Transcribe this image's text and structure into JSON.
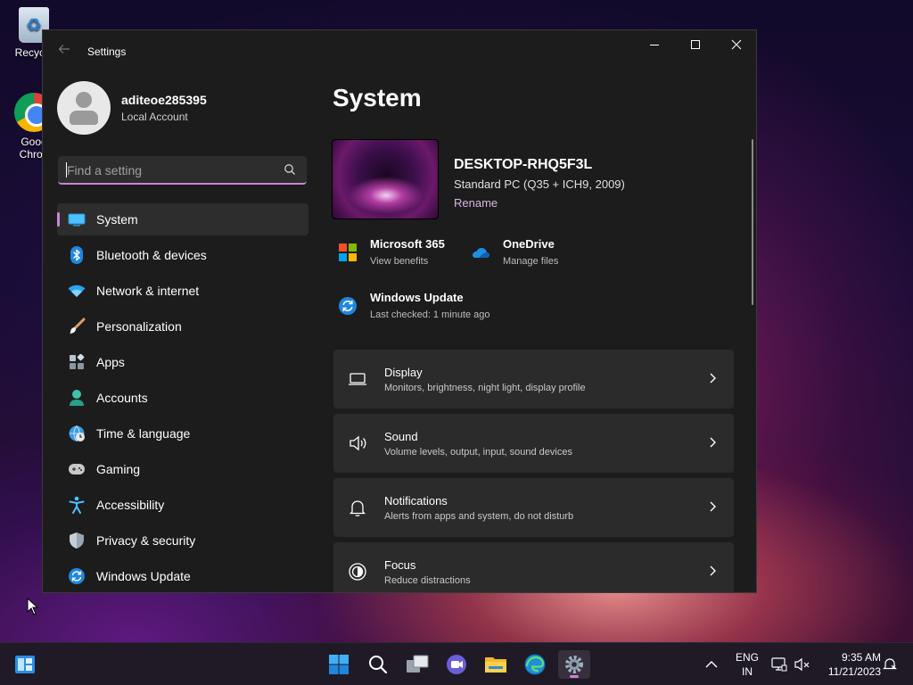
{
  "desktop": {
    "icons": [
      {
        "label": "Recycle"
      },
      {
        "label_line1": "Goog",
        "label_line2": "Chron"
      }
    ]
  },
  "window": {
    "title": "Settings",
    "profile": {
      "name": "aditeoe285395",
      "account_type": "Local Account"
    },
    "search": {
      "placeholder": "Find a setting"
    },
    "nav": [
      {
        "label": "System",
        "icon": "monitor-icon",
        "active": true
      },
      {
        "label": "Bluetooth & devices",
        "icon": "bluetooth-icon"
      },
      {
        "label": "Network & internet",
        "icon": "wifi-icon"
      },
      {
        "label": "Personalization",
        "icon": "brush-icon"
      },
      {
        "label": "Apps",
        "icon": "apps-icon"
      },
      {
        "label": "Accounts",
        "icon": "person-icon"
      },
      {
        "label": "Time & language",
        "icon": "globe-clock-icon"
      },
      {
        "label": "Gaming",
        "icon": "gamepad-icon"
      },
      {
        "label": "Accessibility",
        "icon": "accessibility-icon"
      },
      {
        "label": "Privacy & security",
        "icon": "shield-icon"
      },
      {
        "label": "Windows Update",
        "icon": "update-icon"
      }
    ],
    "content": {
      "page_title": "System",
      "device": {
        "name": "DESKTOP-RHQ5F3L",
        "model": "Standard PC (Q35 + ICH9, 2009)",
        "rename_label": "Rename"
      },
      "quick_links": [
        {
          "title": "Microsoft 365",
          "subtitle": "View benefits",
          "icon": "microsoft-logo-icon"
        },
        {
          "title": "OneDrive",
          "subtitle": "Manage files",
          "icon": "onedrive-cloud-icon"
        },
        {
          "title": "Windows Update",
          "subtitle": "Last checked: 1 minute ago",
          "icon": "update-icon"
        }
      ],
      "cards": [
        {
          "title": "Display",
          "subtitle": "Monitors, brightness, night light, display profile",
          "icon": "laptop-icon"
        },
        {
          "title": "Sound",
          "subtitle": "Volume levels, output, input, sound devices",
          "icon": "speaker-icon"
        },
        {
          "title": "Notifications",
          "subtitle": "Alerts from apps and system, do not disturb",
          "icon": "bell-icon"
        },
        {
          "title": "Focus",
          "subtitle": "Reduce distractions",
          "icon": "focus-icon"
        }
      ]
    }
  },
  "taskbar": {
    "apps": [
      "widgets-icon",
      "start-icon",
      "search-icon",
      "task-view-icon",
      "teams-chat-icon",
      "file-explorer-icon",
      "edge-icon",
      "settings-icon"
    ],
    "active_app": "settings-icon",
    "language_line1": "ENG",
    "language_line2": "IN",
    "time": "9:35 AM",
    "date": "11/21/2023"
  },
  "colors": {
    "accent": "#c983d6",
    "window_bg": "#1c1c1c",
    "card_bg": "#2b2b2b"
  }
}
